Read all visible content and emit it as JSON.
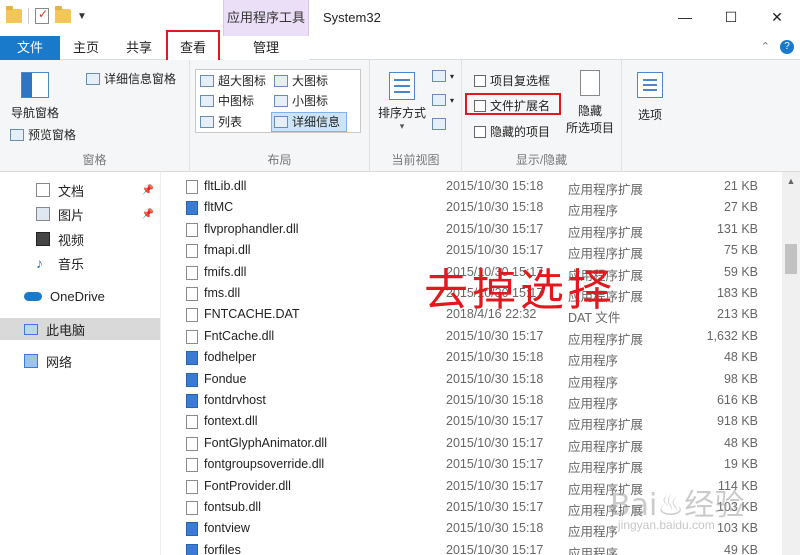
{
  "window": {
    "title": "System32",
    "context_tab": "应用程序工具",
    "minimize": "—",
    "maximize": "☐",
    "close": "✕"
  },
  "tabs": {
    "file": "文件",
    "home": "主页",
    "share": "共享",
    "view": "查看",
    "manage": "管理"
  },
  "ribbon": {
    "pane_group": {
      "label": "窗格",
      "nav_pane": "导航窗格",
      "preview_pane": "预览窗格",
      "details_pane": "详细信息窗格"
    },
    "layout_group": {
      "label": "布局",
      "items": [
        "超大图标",
        "大图标",
        "中图标",
        "小图标",
        "列表",
        "详细信息"
      ],
      "selected": "详细信息"
    },
    "current_view_group": {
      "label": "当前视图",
      "sort_by": "排序方式"
    },
    "show_hide_group": {
      "label": "显示/隐藏",
      "item_checkboxes": "项目复选框",
      "file_extensions": "文件扩展名",
      "hidden_items": "隐藏的项目",
      "hide_selected": "隐藏",
      "hide_selected_line2": "所选项目"
    },
    "options": "选项"
  },
  "navpane": {
    "items": [
      {
        "label": "文档",
        "pinned": true
      },
      {
        "label": "图片",
        "pinned": true
      },
      {
        "label": "视频",
        "pinned": false
      },
      {
        "label": "音乐",
        "pinned": false
      },
      {
        "label": "OneDrive",
        "pinned": false
      },
      {
        "label": "此电脑",
        "pinned": false
      },
      {
        "label": "网络",
        "pinned": false
      }
    ]
  },
  "files": [
    {
      "name": "fltLib.dll",
      "date": "2015/10/30 15:18",
      "type": "应用程序扩展",
      "size": "21 KB",
      "icon": "dll"
    },
    {
      "name": "fltMC",
      "date": "2015/10/30 15:18",
      "type": "应用程序",
      "size": "27 KB",
      "icon": "exe"
    },
    {
      "name": "flvprophandler.dll",
      "date": "2015/10/30 15:17",
      "type": "应用程序扩展",
      "size": "131 KB",
      "icon": "dll"
    },
    {
      "name": "fmapi.dll",
      "date": "2015/10/30 15:17",
      "type": "应用程序扩展",
      "size": "75 KB",
      "icon": "dll"
    },
    {
      "name": "fmifs.dll",
      "date": "2015/10/30 15:17",
      "type": "应用程序扩展",
      "size": "59 KB",
      "icon": "dll"
    },
    {
      "name": "fms.dll",
      "date": "2015/10/30 15:17",
      "type": "应用程序扩展",
      "size": "183 KB",
      "icon": "dll"
    },
    {
      "name": "FNTCACHE.DAT",
      "date": "2018/4/16 22:32",
      "type": "DAT 文件",
      "size": "213 KB",
      "icon": "file"
    },
    {
      "name": "FntCache.dll",
      "date": "2015/10/30 15:17",
      "type": "应用程序扩展",
      "size": "1,632 KB",
      "icon": "dll"
    },
    {
      "name": "fodhelper",
      "date": "2015/10/30 15:18",
      "type": "应用程序",
      "size": "48 KB",
      "icon": "exe"
    },
    {
      "name": "Fondue",
      "date": "2015/10/30 15:18",
      "type": "应用程序",
      "size": "98 KB",
      "icon": "exe"
    },
    {
      "name": "fontdrvhost",
      "date": "2015/10/30 15:18",
      "type": "应用程序",
      "size": "616 KB",
      "icon": "exe"
    },
    {
      "name": "fontext.dll",
      "date": "2015/10/30 15:17",
      "type": "应用程序扩展",
      "size": "918 KB",
      "icon": "dll"
    },
    {
      "name": "FontGlyphAnimator.dll",
      "date": "2015/10/30 15:17",
      "type": "应用程序扩展",
      "size": "48 KB",
      "icon": "dll"
    },
    {
      "name": "fontgroupsoverride.dll",
      "date": "2015/10/30 15:17",
      "type": "应用程序扩展",
      "size": "19 KB",
      "icon": "dll"
    },
    {
      "name": "FontProvider.dll",
      "date": "2015/10/30 15:17",
      "type": "应用程序扩展",
      "size": "114 KB",
      "icon": "dll"
    },
    {
      "name": "fontsub.dll",
      "date": "2015/10/30 15:17",
      "type": "应用程序扩展",
      "size": "103 KB",
      "icon": "dll"
    },
    {
      "name": "fontview",
      "date": "2015/10/30 15:18",
      "type": "应用程序",
      "size": "103 KB",
      "icon": "exe"
    },
    {
      "name": "forfiles",
      "date": "2015/10/30 15:17",
      "type": "应用程序",
      "size": "49 KB",
      "icon": "exe"
    }
  ],
  "annotation": "去掉选择",
  "watermark": "Bai♨经验",
  "watermark_sub": "jingyan.baidu.com",
  "colors": {
    "accent": "#1979ca",
    "highlight_red": "#e0191e",
    "context_tab_bg": "#eadff6"
  }
}
